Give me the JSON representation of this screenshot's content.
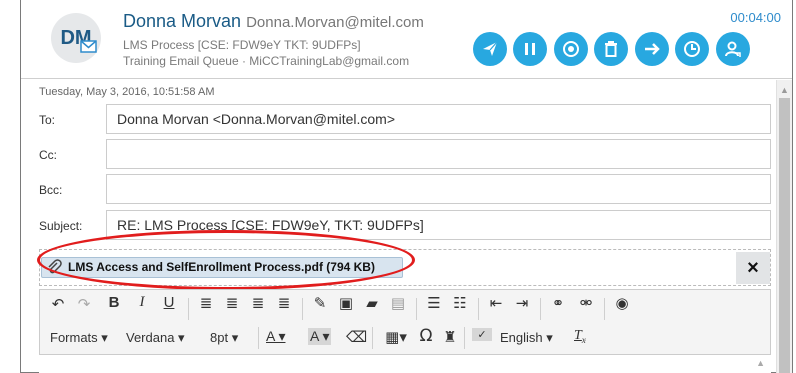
{
  "sender": {
    "initials": "DM",
    "name": "Donna Morvan",
    "email": "Donna.Morvan@mitel.com",
    "subject_line": "LMS Process [CSE: FDW9eY TKT: 9UDFPs]",
    "queue_line": "Training Email Queue · MiCCTrainingLab@gmail.com"
  },
  "timer": "00:04:00",
  "actions": [
    {
      "icon": "send-icon"
    },
    {
      "icon": "pause-icon"
    },
    {
      "icon": "record-icon"
    },
    {
      "icon": "delete-icon"
    },
    {
      "icon": "forward-icon"
    },
    {
      "icon": "schedule-icon"
    },
    {
      "icon": "transfer-user-icon"
    }
  ],
  "accent_color": "#28a8e0",
  "message": {
    "date": "Tuesday, May 3, 2016, 10:51:58 AM",
    "to_label": "To:",
    "to_value": "Donna Morvan <Donna.Morvan@mitel.com>",
    "cc_label": "Cc:",
    "cc_value": "",
    "bcc_label": "Bcc:",
    "bcc_value": "",
    "subject_label": "Subject:",
    "subject_value": "RE: LMS Process [CSE: FDW9eY, TKT: 9UDFPs]"
  },
  "attachment": {
    "filename": "LMS Access and SelfEnrollment Process.pdf (794 KB)",
    "remove": "×"
  },
  "toolbar": {
    "formats": "Formats",
    "font": "Verdana",
    "size": "8pt",
    "language": "English"
  }
}
